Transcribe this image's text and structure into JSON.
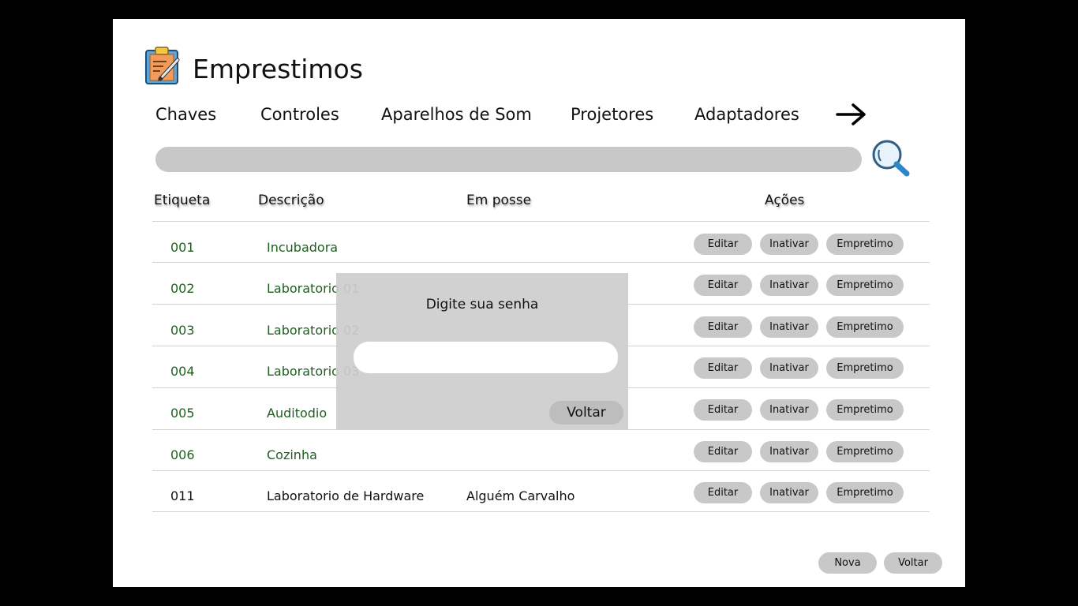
{
  "header": {
    "title": "Emprestimos",
    "logo_icon": "clipboard-pencil-icon"
  },
  "tabs": [
    {
      "label": "Chaves"
    },
    {
      "label": "Controles"
    },
    {
      "label": "Aparelhos de Som"
    },
    {
      "label": "Projetores"
    },
    {
      "label": "Adaptadores"
    }
  ],
  "next_icon": "arrow-right-icon",
  "search": {
    "icon": "magnifier-icon",
    "value": ""
  },
  "table": {
    "headers": {
      "etiqueta": "Etiqueta",
      "descricao": "Descrição",
      "em_posse": "Em posse",
      "acoes": "Ações"
    },
    "rows": [
      {
        "etiqueta": "001",
        "descricao": "Incubadora",
        "em_posse": "",
        "status": "available"
      },
      {
        "etiqueta": "002",
        "descricao": "Laboratorio 01",
        "em_posse": "",
        "status": "available"
      },
      {
        "etiqueta": "003",
        "descricao": "Laboratorio 02",
        "em_posse": "",
        "status": "available"
      },
      {
        "etiqueta": "004",
        "descricao": "Laboratorio 03",
        "em_posse": "",
        "status": "available"
      },
      {
        "etiqueta": "005",
        "descricao": "Auditodio",
        "em_posse": "",
        "status": "available"
      },
      {
        "etiqueta": "006",
        "descricao": "Cozinha",
        "em_posse": "",
        "status": "available"
      },
      {
        "etiqueta": "011",
        "descricao": "Laboratorio de Hardware",
        "em_posse": "Alguém Carvalho",
        "status": "loaned"
      }
    ],
    "actions": {
      "edit": "Editar",
      "inactivate": "Inativar",
      "loan": "Empretimo"
    }
  },
  "modal": {
    "title": "Digite sua senha",
    "password_value": "",
    "back_label": "Voltar"
  },
  "footer": {
    "new_label": "Nova",
    "back_label": "Voltar"
  },
  "colors": {
    "available_text": "#1f5e1f",
    "loaned_text": "#111111",
    "button_bg": "#c8c8c8"
  }
}
